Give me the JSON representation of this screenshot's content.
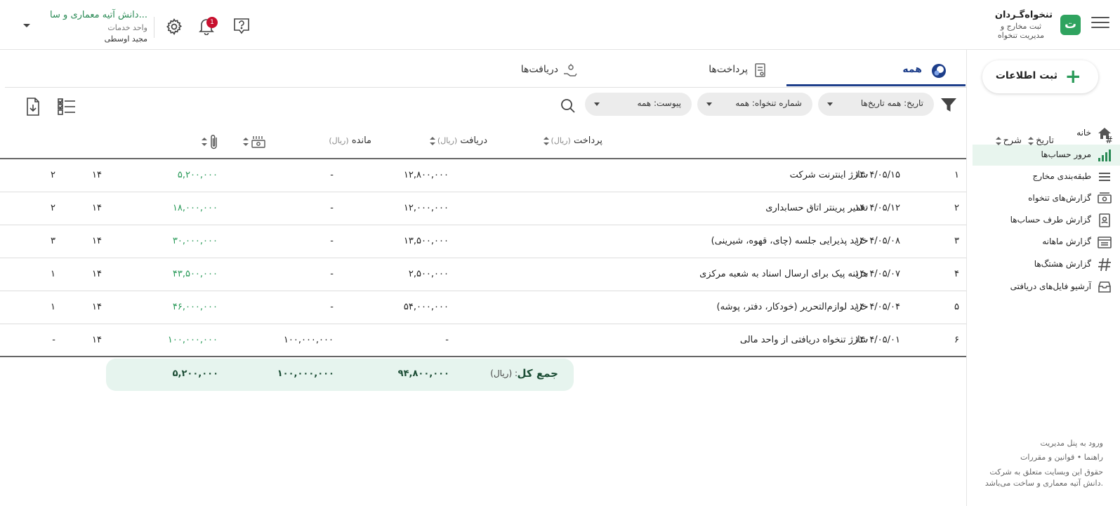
{
  "app": {
    "name": "تنخواه‌گـردان",
    "subtitle": "ثبت مخارج و مدیریت تنخواه",
    "logo_letter": "ت",
    "brand_color": "#2fa35f"
  },
  "header": {
    "org_name": "دانش آتیه معماری و سا...",
    "org_unit": "واحد خدمات",
    "user_name": "مجید اوسطی",
    "notification_count": "1"
  },
  "sidebar": {
    "new_button_label": "ثبت اطلاعات",
    "items": [
      {
        "label": "خانه",
        "icon": "home-icon"
      },
      {
        "label": "مرور حساب‌ها",
        "icon": "bar-chart-icon",
        "active": true
      },
      {
        "label": "طبقه‌بندی مخارج",
        "icon": "list-icon"
      },
      {
        "label": "گزارش‌های تنخواه",
        "icon": "cash-icon"
      },
      {
        "label": "گزارش طرف حساب‌ها",
        "icon": "contact-icon"
      },
      {
        "label": "گزارش ماهانه",
        "icon": "calendar-icon"
      },
      {
        "label": "گزارش هشتگ‌ها",
        "icon": "hashtag-icon"
      },
      {
        "label": "آرشیو فایل‌های دریافتی",
        "icon": "archive-icon"
      }
    ],
    "footer": {
      "admin_link": "ورود به پنل مدیریت",
      "help_link": "راهنما",
      "rules_link": "قوانین و مقررات",
      "copyright": "حقوق این وبسایت متعلق به شرکت دانش آتیه معماری و ساخت می‌باشد."
    }
  },
  "tabs": [
    {
      "label": "همه",
      "icon": "all-icon",
      "active": true
    },
    {
      "label": "پرداخت‌ها",
      "icon": "payments-icon"
    },
    {
      "label": "دریافت‌ها",
      "icon": "receipts-icon"
    }
  ],
  "filters": {
    "date": "تاریخ: همه تاریخ‌ها",
    "fund": "شماره تنخواه: همه",
    "attachment": "پیوست: همه"
  },
  "table": {
    "columns": {
      "num": "#",
      "date": "تاریخ",
      "desc": "شرح",
      "pay": "پرداخت",
      "rec": "دریافت",
      "bal": "مانده",
      "unit": "(ریال)"
    },
    "rows": [
      {
        "num": "۱",
        "date": "۱۴۰۴/۰۵/۱۵",
        "desc": "شارژ اینترنت شرکت",
        "pay": "۱۲,۸۰۰,۰۰۰",
        "rec": "-",
        "bal": "۵,۲۰۰,۰۰۰",
        "fund": "۱۴",
        "att": "۲"
      },
      {
        "num": "۲",
        "date": "۱۴۰۴/۰۵/۱۲",
        "desc": "تعمیر پرینتر اتاق حسابداری",
        "pay": "۱۲,۰۰۰,۰۰۰",
        "rec": "-",
        "bal": "۱۸,۰۰۰,۰۰۰",
        "fund": "۱۴",
        "att": "۲"
      },
      {
        "num": "۳",
        "date": "۱۴۰۴/۰۵/۰۸",
        "desc": "خرید پذیرایی جلسه (چای، قهوه، شیرینی)",
        "pay": "۱۳,۵۰۰,۰۰۰",
        "rec": "-",
        "bal": "۳۰,۰۰۰,۰۰۰",
        "fund": "۱۴",
        "att": "۳"
      },
      {
        "num": "۴",
        "date": "۱۴۰۴/۰۵/۰۷",
        "desc": "هزینه پیک برای ارسال اسناد به شعبه مرکزی",
        "pay": "۲,۵۰۰,۰۰۰",
        "rec": "-",
        "bal": "۴۳,۵۰۰,۰۰۰",
        "fund": "۱۴",
        "att": "۱"
      },
      {
        "num": "۵",
        "date": "۱۴۰۴/۰۵/۰۴",
        "desc": "خرید لوازم‌التحریر (خودکار، دفتر، پوشه)",
        "pay": "۵۴,۰۰۰,۰۰۰",
        "rec": "-",
        "bal": "۴۶,۰۰۰,۰۰۰",
        "fund": "۱۴",
        "att": "۱"
      },
      {
        "num": "۶",
        "date": "۱۴۰۴/۰۵/۰۱",
        "desc": "شارژ تنخواه دریافتی از واحد مالی",
        "pay": "-",
        "rec": "۱۰۰,۰۰۰,۰۰۰",
        "bal": "۱۰۰,۰۰۰,۰۰۰",
        "fund": "۱۴",
        "att": "-"
      }
    ],
    "total": {
      "label": "جمع کل",
      "unit": "(ریال) :",
      "pay": "۹۴,۸۰۰,۰۰۰",
      "rec": "۱۰۰,۰۰۰,۰۰۰",
      "bal": "۵,۲۰۰,۰۰۰"
    }
  }
}
